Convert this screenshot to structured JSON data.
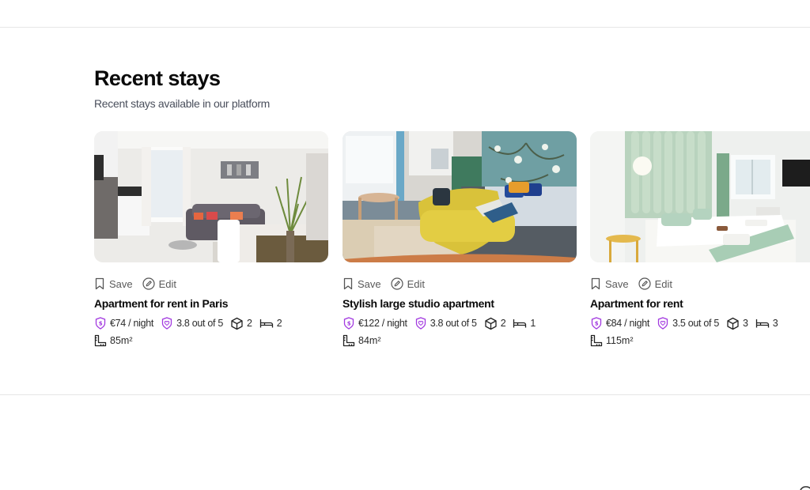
{
  "section": {
    "title": "Recent stays",
    "subtitle": "Recent stays available in our platform"
  },
  "actions": {
    "save_label": "Save",
    "edit_label": "Edit"
  },
  "colors": {
    "accent": "#a23ae0",
    "text": "#111111",
    "muted": "#5a5a5a",
    "divider": "#e6e6e6"
  },
  "stays": [
    {
      "title": "Apartment for rent in Paris",
      "price": "€74 / night",
      "rating": "3.8 out of 5",
      "rooms": "2",
      "beds": "2",
      "area": "85m²",
      "photo": "living-room-photo"
    },
    {
      "title": "Stylish large studio apartment",
      "price": "€122 / night",
      "rating": "3.8 out of 5",
      "rooms": "2",
      "beds": "1",
      "area": "84m²",
      "photo": "studio-photo"
    },
    {
      "title": "Apartment for rent",
      "price": "€84 / night",
      "rating": "3.5 out of 5",
      "rooms": "3",
      "beds": "3",
      "area": "115m²",
      "photo": "bedroom-photo"
    }
  ]
}
